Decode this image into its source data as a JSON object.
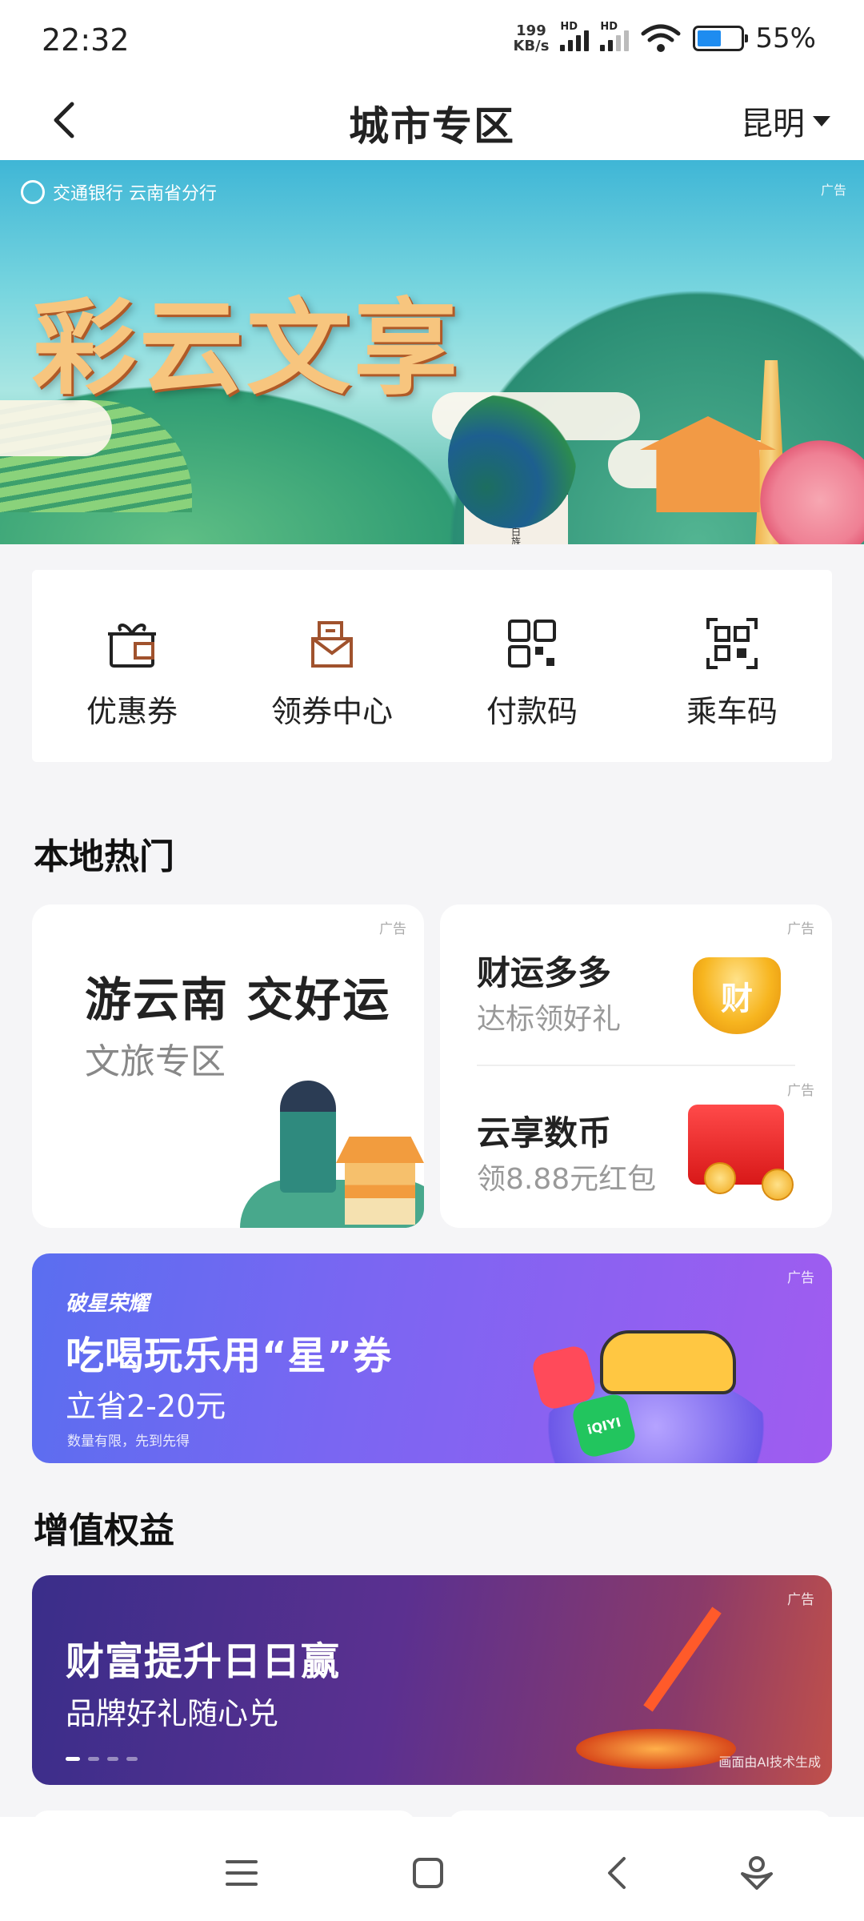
{
  "status_bar": {
    "time": "22:32",
    "net_speed_value": "199",
    "net_speed_unit": "KB/s",
    "hd_label": "HD",
    "battery_percent": "55%",
    "battery_level": 0.55
  },
  "header": {
    "title": "城市专区",
    "city": "昆明"
  },
  "hero": {
    "brand": "交通银行 云南省分行",
    "ad_tag": "广告",
    "title": "彩云文享",
    "gate_text": "大理白族"
  },
  "quick_actions": [
    {
      "label": "优惠券",
      "icon": "gift-coupon-icon"
    },
    {
      "label": "领券中心",
      "icon": "coupon-center-icon"
    },
    {
      "label": "付款码",
      "icon": "qr-code-icon"
    },
    {
      "label": "乘车码",
      "icon": "scan-qr-icon"
    }
  ],
  "local_hot": {
    "title": "本地热门",
    "card_travel": {
      "ad_tag": "广告",
      "title": "游云南 交好运",
      "subtitle": "文旅专区"
    },
    "card_fortune": {
      "ad_tag": "广告",
      "title": "财运多多",
      "subtitle": "达标领好礼",
      "badge": "财"
    },
    "card_ecny": {
      "ad_tag": "广告",
      "title": "云享数币",
      "subtitle": "领8.88元红包"
    }
  },
  "promo_star": {
    "ad_tag": "广告",
    "brand": "破星荣耀",
    "title": "吃喝玩乐用“星”券",
    "subtitle": "立省2-20元",
    "note": "数量有限，先到先得",
    "app_badge": "iQIYI"
  },
  "value_added": {
    "title": "增值权益",
    "banner": {
      "ad_tag": "广告",
      "title": "财富提升日日赢",
      "subtitle": "品牌好礼随心兑",
      "ai_note": "画面由AI技术生成",
      "page_count": 4,
      "active_page": 1
    }
  },
  "colors": {
    "accent_brown": "#a0522d",
    "icon_dark": "#333333",
    "promo_purple": "#7a66f2",
    "wealth_indigo": "#3a2e8a"
  }
}
